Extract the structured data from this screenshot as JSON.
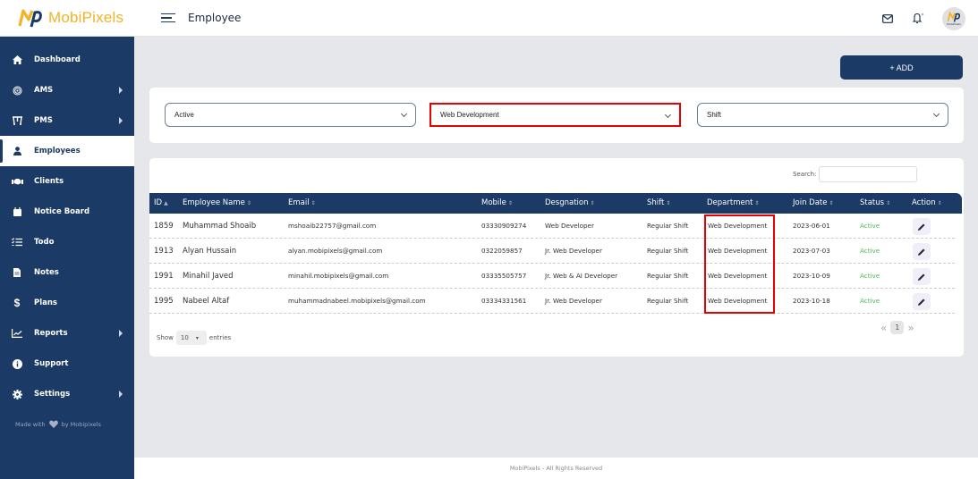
{
  "brand": {
    "name": "MobiPixels",
    "avatar_caption": "MobiPixels"
  },
  "header": {
    "title": "Employee",
    "icons": [
      "mail-icon",
      "bell-icon"
    ]
  },
  "colors": {
    "primary": "#1c3a66",
    "brand_accent": "#f4b326",
    "status_active": "#4cbf5a",
    "highlight": "#e60000"
  },
  "sidebar": {
    "items": [
      {
        "label": "Dashboard",
        "icon": "home-icon",
        "has_submenu": false
      },
      {
        "label": "AMS",
        "icon": "fingerprint-icon",
        "has_submenu": true
      },
      {
        "label": "PMS",
        "icon": "project-icon",
        "has_submenu": true
      },
      {
        "label": "Employees",
        "icon": "user-icon",
        "has_submenu": false,
        "active": true
      },
      {
        "label": "Clients",
        "icon": "handshake-icon",
        "has_submenu": false
      },
      {
        "label": "Notice Board",
        "icon": "calendar-icon",
        "has_submenu": false
      },
      {
        "label": "Todo",
        "icon": "checklist-icon",
        "has_submenu": false
      },
      {
        "label": "Notes",
        "icon": "file-icon",
        "has_submenu": false
      },
      {
        "label": "Plans",
        "icon": "dollar-icon",
        "has_submenu": false
      },
      {
        "label": "Reports",
        "icon": "chart-icon",
        "has_submenu": true
      },
      {
        "label": "Support",
        "icon": "info-icon",
        "has_submenu": false
      },
      {
        "label": "Settings",
        "icon": "gear-icon",
        "has_submenu": true
      }
    ],
    "made_with_prefix": "Made with",
    "made_with_suffix": "by Mobipixels"
  },
  "toolbar": {
    "add_label": "+ ADD"
  },
  "filters": {
    "status": "Active",
    "department": "Web Development",
    "shift": "Shift"
  },
  "table": {
    "search_label": "Search:",
    "search_value": "",
    "columns": [
      "ID",
      "Employee Name",
      "Email",
      "Mobile",
      "Desgnation",
      "Shift",
      "Department",
      "Join Date",
      "Status",
      "Action"
    ],
    "rows": [
      {
        "id": "1859",
        "name": "Muhammad Shoaib",
        "email": "mshoaib22757@gmail.com",
        "mobile": "03330909274",
        "designation": "Web Developer",
        "shift": "Regular Shift",
        "department": "Web Development",
        "join_date": "2023-06-01",
        "status": "Active"
      },
      {
        "id": "1913",
        "name": "Alyan Hussain",
        "email": "alyan.mobipixels@gmail.com",
        "mobile": "0322059857",
        "designation": "Jr. Web Developer",
        "shift": "Regular Shift",
        "department": "Web Development",
        "join_date": "2023-07-03",
        "status": "Active"
      },
      {
        "id": "1991",
        "name": "Minahil Javed",
        "email": "minahil.mobipixels@gmail.com",
        "mobile": "03335505757",
        "designation": "Jr. Web & AI Developer",
        "shift": "Regular Shift",
        "department": "Web Development",
        "join_date": "2023-10-09",
        "status": "Active"
      },
      {
        "id": "1995",
        "name": "Nabeel Altaf",
        "email": "muhammadnabeel.mobipixels@gmail.com",
        "mobile": "03334331561",
        "designation": "Jr. Web Developer",
        "shift": "Regular Shift",
        "department": "Web Development",
        "join_date": "2023-10-18",
        "status": "Active"
      }
    ],
    "show_label": "Show",
    "entries_label": "entries",
    "page_length": "10",
    "pagination": {
      "prev": "«",
      "current": "1",
      "next": "»"
    }
  },
  "footer": {
    "text": "MobiPixels - All Rights Reserved"
  }
}
